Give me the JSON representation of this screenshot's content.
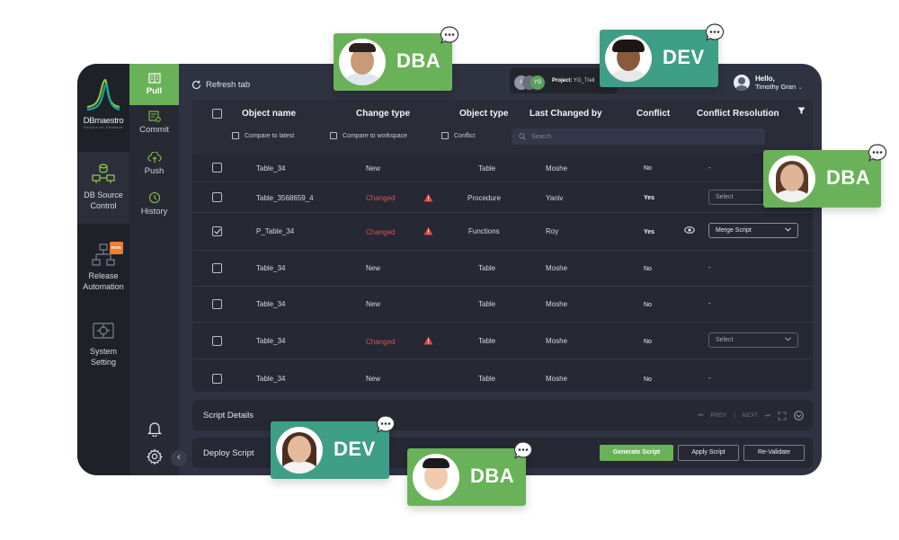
{
  "colors": {
    "accent": "#6ab259",
    "dev_card": "#3f9e86",
    "dba_card": "#6ab259",
    "changed": "#d9534f",
    "warning": "#e2493f"
  },
  "logo": {
    "name": "DBmaestro",
    "tagline": "DevOps for Database"
  },
  "rail": {
    "items": [
      {
        "label": "DB Source Control",
        "icon": "database-sync-icon"
      },
      {
        "label": "Release Automation",
        "icon": "workflow-icon",
        "badge": "NEW"
      },
      {
        "label": "System Setting",
        "icon": "settings-panel-icon"
      }
    ]
  },
  "subnav": {
    "items": [
      {
        "label": "Pull",
        "icon": "pull-icon",
        "active": true
      },
      {
        "label": "Commit",
        "icon": "commit-icon"
      },
      {
        "label": "Push",
        "icon": "cloud-upload-icon"
      },
      {
        "label": "History",
        "icon": "history-icon"
      }
    ],
    "bell_icon": "bell-icon",
    "gear_icon": "gear-icon",
    "collapse_icon": "chevron-left-icon"
  },
  "topbar": {
    "refresh_label": "Refresh tab",
    "project_prefix": "Project:",
    "project_name": "YG_Trell",
    "avatars": [
      "A",
      "",
      "YG"
    ],
    "user_greeting": "Hello,",
    "user_name": "Timothy Gran"
  },
  "table": {
    "headers": [
      "Object name",
      "Change type",
      "Object type",
      "Last Changed by",
      "Conflict",
      "Conflict Resolution"
    ],
    "filters": [
      "Compare to latest",
      "Compare to workspace",
      "Conflict"
    ],
    "search_placeholder": "Search",
    "rows": [
      {
        "name": "Table_34",
        "change": "New",
        "changed": false,
        "type": "Table",
        "by": "Moshe",
        "conflict": "No",
        "resolution": "-",
        "checked": false
      },
      {
        "name": "Table_3568659_4",
        "change": "Changed",
        "changed": true,
        "type": "Procedure",
        "by": "Yaniv",
        "conflict": "Yes",
        "resolution": "Select",
        "checked": false
      },
      {
        "name": "P_Table_34",
        "change": "Changed",
        "changed": true,
        "type": "Functions",
        "by": "Roy",
        "conflict": "Yes",
        "resolution": "Merge Script",
        "checked": true
      },
      {
        "name": "Table_34",
        "change": "New",
        "changed": false,
        "type": "Table",
        "by": "Moshe",
        "conflict": "No",
        "resolution": "-",
        "checked": false
      },
      {
        "name": "Table_34",
        "change": "New",
        "changed": false,
        "type": "Table",
        "by": "Moshe",
        "conflict": "No",
        "resolution": "-",
        "checked": false
      },
      {
        "name": "Table_34",
        "change": "Changed",
        "changed": true,
        "type": "Table",
        "by": "Moshe",
        "conflict": "No",
        "resolution": "Select",
        "checked": false
      },
      {
        "name": "Table_34",
        "change": "New",
        "changed": false,
        "type": "Table",
        "by": "Moshe",
        "conflict": "No",
        "resolution": "-",
        "checked": false
      }
    ]
  },
  "script_details": {
    "title": "Script Details",
    "prev": "PREV",
    "next": "NEXT"
  },
  "deploy": {
    "title": "Deploy Script",
    "generate": "Generate Script",
    "apply": "Apply Script",
    "revalidate": "Re-Validate"
  },
  "personas": [
    "DBA",
    "DEV",
    "DBA",
    "DEV",
    "DBA"
  ]
}
